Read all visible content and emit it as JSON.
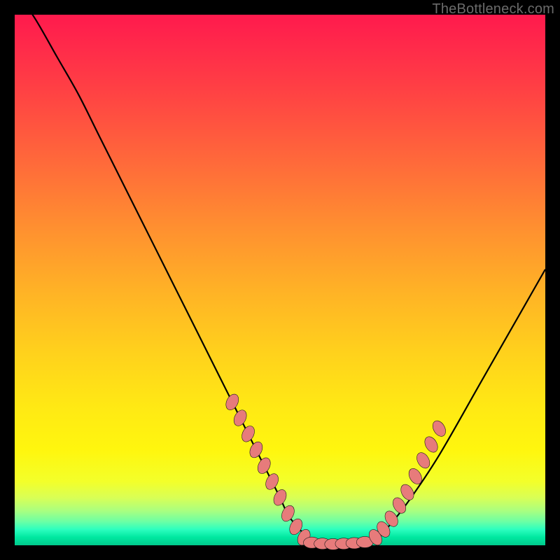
{
  "watermark": "TheBottleneck.com",
  "colors": {
    "background": "#000000",
    "curve_stroke": "#000000",
    "marker_fill": "#e77b7b",
    "marker_stroke": "#1a1a1a"
  },
  "chart_data": {
    "type": "line",
    "title": "",
    "xlabel": "",
    "ylabel": "",
    "xlim": [
      0,
      100
    ],
    "ylim": [
      0,
      100
    ],
    "grid": false,
    "series": [
      {
        "name": "bottleneck-curve",
        "x": [
          0,
          4,
          8,
          12,
          16,
          20,
          24,
          28,
          32,
          36,
          40,
          44,
          48,
          50,
          52,
          56,
          60,
          62,
          64,
          66,
          68,
          70,
          74,
          80,
          88,
          96,
          100
        ],
        "y": [
          105,
          99,
          92,
          85,
          77,
          69,
          61,
          53,
          45,
          37,
          29,
          21,
          13,
          9,
          5,
          1,
          0,
          0,
          0,
          0,
          1,
          3,
          8,
          17,
          31,
          45,
          52
        ]
      }
    ],
    "markers": [
      {
        "x": 41.0,
        "y": 27.0
      },
      {
        "x": 42.5,
        "y": 24.0
      },
      {
        "x": 44.0,
        "y": 21.0
      },
      {
        "x": 45.5,
        "y": 18.0
      },
      {
        "x": 47.0,
        "y": 15.0
      },
      {
        "x": 48.5,
        "y": 12.0
      },
      {
        "x": 50.0,
        "y": 9.0
      },
      {
        "x": 51.5,
        "y": 6.0
      },
      {
        "x": 53.0,
        "y": 3.5
      },
      {
        "x": 54.5,
        "y": 1.5
      },
      {
        "x": 56.0,
        "y": 0.5
      },
      {
        "x": 58.0,
        "y": 0.3
      },
      {
        "x": 60.0,
        "y": 0.2
      },
      {
        "x": 62.0,
        "y": 0.3
      },
      {
        "x": 64.0,
        "y": 0.4
      },
      {
        "x": 66.0,
        "y": 0.6
      },
      {
        "x": 68.0,
        "y": 1.5
      },
      {
        "x": 69.5,
        "y": 3.0
      },
      {
        "x": 71.0,
        "y": 5.0
      },
      {
        "x": 72.5,
        "y": 7.5
      },
      {
        "x": 74.0,
        "y": 10.0
      },
      {
        "x": 75.5,
        "y": 13.0
      },
      {
        "x": 77.0,
        "y": 16.0
      },
      {
        "x": 78.5,
        "y": 19.0
      },
      {
        "x": 80.0,
        "y": 22.0
      }
    ]
  }
}
